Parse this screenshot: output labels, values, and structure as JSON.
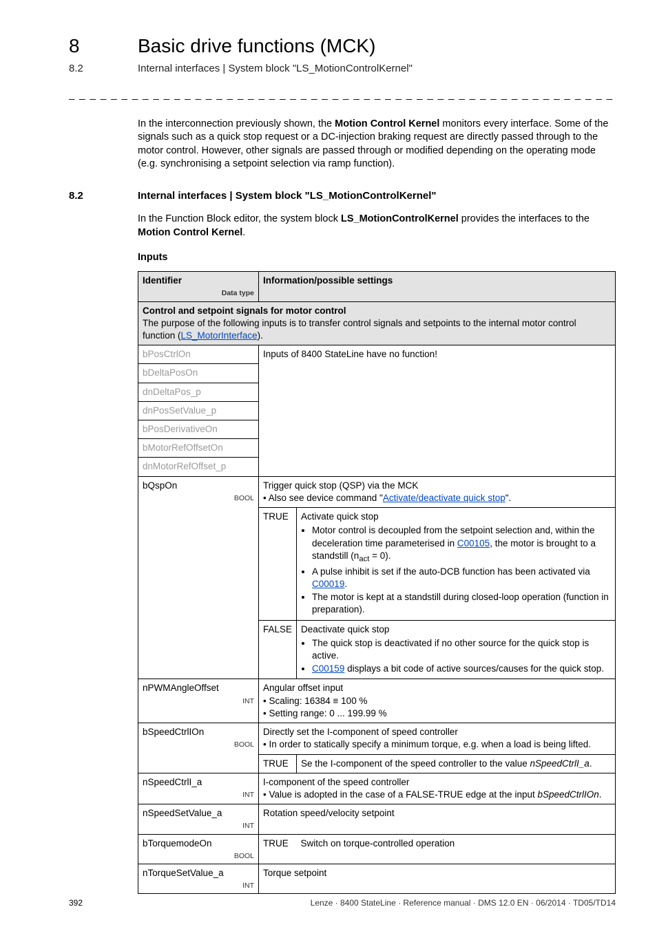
{
  "header": {
    "chapter_num": "8",
    "chapter_title": "Basic drive functions (MCK)",
    "section_num": "8.2",
    "section_title": "Internal interfaces | System block \"LS_MotionControlKernel\""
  },
  "dashline": "_ _ _ _ _ _ _ _ _ _ _ _ _ _ _ _ _ _ _ _ _ _ _ _ _ _ _ _ _ _ _ _ _ _ _ _ _ _ _ _ _ _ _ _ _ _ _ _ _ _ _ _ _ _ _ _ _ _ _ _ _ _ _ _",
  "intro_para": "In the interconnection previously shown, the <b>Motion Control Kernel</b> monitors every interface. Some of the signals such as a quick stop request or a DC-injection braking request are directly passed through to the motor control. However, other signals are passed through or modified depending on the operating mode (e.g. synchronising a setpoint selection via ramp function).",
  "section": {
    "num": "8.2",
    "title": "Internal interfaces | System block \"LS_MotionControlKernel\"",
    "para": "In the Function Block editor, the system block <b>LS_MotionControlKernel</b> provides the interfaces to the <b>Motion Control Kernel</b>.",
    "inputs_label": "Inputs"
  },
  "table": {
    "head_id": "Identifier",
    "head_dtype": "Data type",
    "head_info": "Information/possible settings",
    "group_header_bold": "Control and setpoint signals for motor control",
    "group_header_rest": "The purpose of the following inputs is to transfer control signals and setpoints to the internal motor control function (",
    "group_header_link": "LS_MotorInterface",
    "group_header_close": ").",
    "nofunc": "Inputs of 8400 StateLine have no function!",
    "rows_nofunc": [
      "bPosCtrlOn",
      "bDeltaPosOn",
      "dnDeltaPos_p",
      "dnPosSetValue_p",
      "bPosDerivativeOn",
      "bMotorRefOffsetOn",
      "dnMotorRefOffset_p"
    ],
    "bqsp_id": "bQspOn",
    "bqsp_type": "BOOL",
    "bqsp_desc_a": "Trigger quick stop (QSP) via the MCK",
    "bqsp_desc_b_pre": "• Also see device command \"",
    "bqsp_desc_b_link": "Activate/deactivate quick stop",
    "bqsp_desc_b_post": "\".",
    "true_label": "TRUE",
    "false_label": "FALSE",
    "bqsp_true_title": "Activate quick stop",
    "bqsp_true_b1": "Motor control is decoupled from the setpoint selection and, within the deceleration time parameterised in ",
    "bqsp_true_b1_link": "C00105",
    "bqsp_true_b1_post": ", the motor is brought to a standstill (n",
    "bqsp_true_b1_sub": "act",
    "bqsp_true_b1_end": " = 0).",
    "bqsp_true_b2_pre": "A pulse inhibit is set if the auto-DCB function has been activated via ",
    "bqsp_true_b2_link": "C00019",
    "bqsp_true_b2_post": ".",
    "bqsp_true_b3": "The motor is kept at a standstill during closed-loop operation (function in preparation).",
    "bqsp_false_title": "Deactivate quick stop",
    "bqsp_false_b1": "The quick stop is deactivated if no other source for the quick stop is active.",
    "bqsp_false_b2_link": "C00159",
    "bqsp_false_b2_post": " displays a bit code of active sources/causes for the quick stop.",
    "pwm_id": "nPWMAngleOffset",
    "pwm_type": "INT",
    "pwm_l1": "Angular offset input",
    "pwm_l2": "• Scaling: 16384 ≡ 100 %",
    "pwm_l3": "• Setting range: 0 ... 199.99 %",
    "bsci_id": "bSpeedCtrlIOn",
    "bsci_type": "BOOL",
    "bsci_l1": "Directly set the I-component of speed controller",
    "bsci_l2": "• In order to statically specify a minimum torque, e.g. when a load is being lifted.",
    "bsci_true_a": "Se the I-component of the speed controller to the value ",
    "bsci_true_b": "nSpeedCtrlI_a",
    "bsci_true_c": ".",
    "nsci_id": "nSpeedCtrlI_a",
    "nsci_type": "INT",
    "nsci_l1": "I-component of the speed controller",
    "nsci_l2_a": "• Value is adopted in the case of a FALSE-TRUE edge at the input ",
    "nsci_l2_b": "bSpeedCtrlIOn",
    "nsci_l2_c": ".",
    "nssv_id": "nSpeedSetValue_a",
    "nssv_type": "INT",
    "nssv_desc": "Rotation speed/velocity setpoint",
    "btm_id": "bTorquemodeOn",
    "btm_type": "BOOL",
    "btm_true": "Switch on torque-controlled operation",
    "ntsv_id": "nTorqueSetValue_a",
    "ntsv_type": "INT",
    "ntsv_desc": "Torque setpoint"
  },
  "footer": {
    "page": "392",
    "meta": "Lenze · 8400 StateLine · Reference manual · DMS 12.0 EN · 06/2014 · TD05/TD14"
  }
}
